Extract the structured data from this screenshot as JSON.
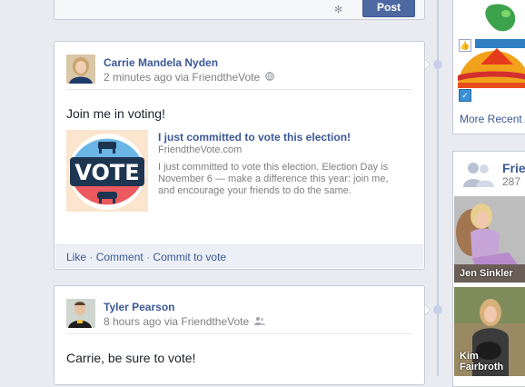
{
  "composer": {
    "post_label": "Post"
  },
  "stories": [
    {
      "author": "Carrie Mandela Nyden",
      "time": "2 minutes ago",
      "via_prefix": "via",
      "app": "FriendtheVote",
      "message": "Join me in voting!",
      "attachment": {
        "badge_text": "VOTE",
        "title": "I just committed to vote this election!",
        "domain": "FriendtheVote.com",
        "description": "I just committed to vote this election. Election Day is November 6 — make a difference this year: join me, and encourage your friends to do the same."
      },
      "actions": {
        "like": "Like",
        "comment": "Comment",
        "commit": "Commit to vote",
        "separator": "·"
      }
    },
    {
      "author": "Tyler Pearson",
      "time": "8 hours ago",
      "via_prefix": "via",
      "app": "FriendtheVote",
      "message": "Carrie, be sure to vote!"
    }
  ],
  "sidebar": {
    "more_recent": "More Recent A",
    "friends_title": "Frien",
    "friends_count": "287",
    "friends": [
      {
        "name": "Jen Sinkler"
      },
      {
        "name": "Kim Fairbroth"
      }
    ]
  },
  "colors": {
    "link": "#3b5998",
    "button": "#4e69a2",
    "page_bg": "#e9ebf0"
  }
}
